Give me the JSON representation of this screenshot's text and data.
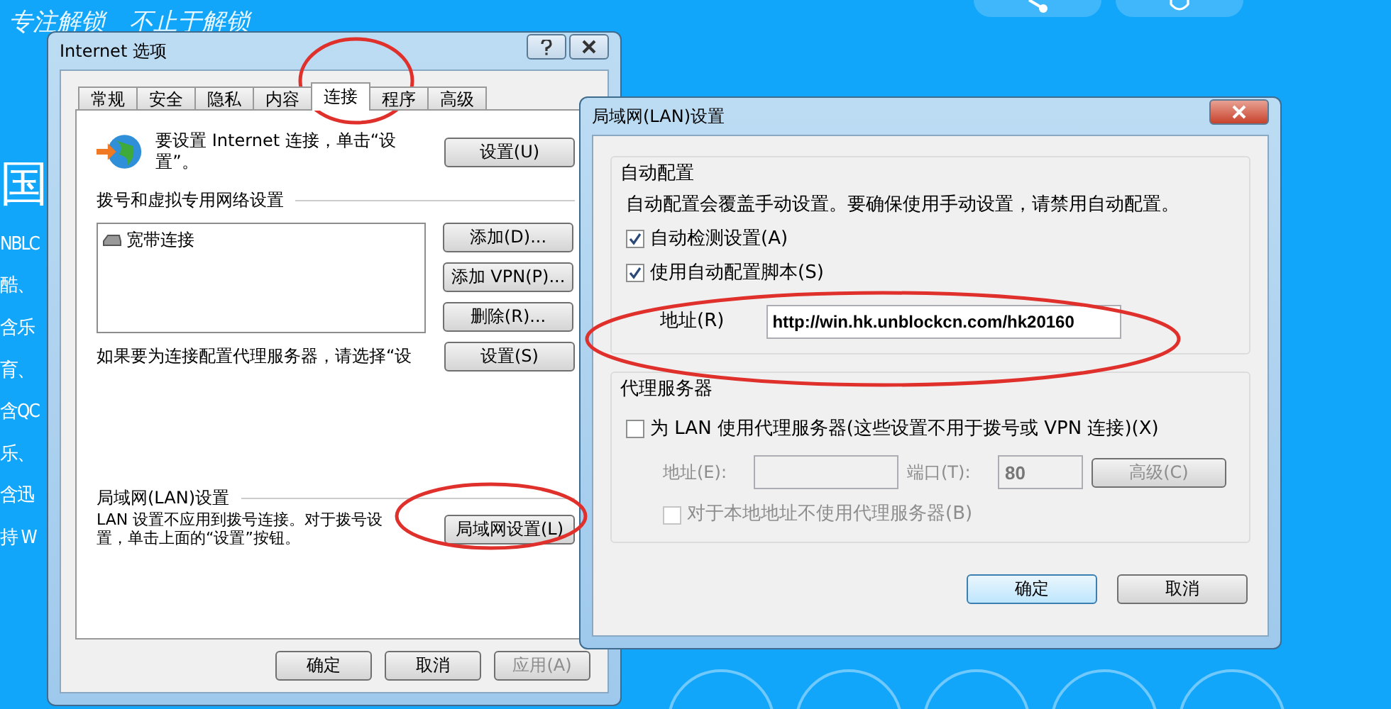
{
  "page": {
    "slogan": "专注解锁　不止于解锁",
    "side_texts": [
      "国",
      "NBLC",
      "酷、",
      "含乐",
      "育、",
      "含QC",
      "乐、",
      "含迅",
      "持 W"
    ]
  },
  "internet_options": {
    "title": "Internet 选项",
    "tabs": [
      {
        "label": "常规",
        "selected": false
      },
      {
        "label": "安全",
        "selected": false
      },
      {
        "label": "隐私",
        "selected": false
      },
      {
        "label": "内容",
        "selected": false
      },
      {
        "label": "连接",
        "selected": true
      },
      {
        "label": "程序",
        "selected": false
      },
      {
        "label": "高级",
        "selected": false
      }
    ],
    "setup_text": "要设置 Internet 连接，单击“设置”。",
    "setup_button": "设置(U)",
    "dialup_heading": "拨号和虚拟专用网络设置",
    "connections": [
      "宽带连接"
    ],
    "dialup_buttons": [
      "添加(D)...",
      "添加 VPN(P)...",
      "删除(R)..."
    ],
    "proxy_text": "如果要为连接配置代理服务器，请选择“设",
    "proxy_button": "设置(S)",
    "lan_heading": "局域网(LAN)设置",
    "lan_text": "LAN 设置不应用到拨号连接。对于拨号设置，单击上面的“设置”按钮。",
    "lan_button": "局域网设置(L)",
    "footer_buttons": [
      {
        "label": "确定",
        "disabled": false
      },
      {
        "label": "取消",
        "disabled": false
      },
      {
        "label": "应用(A)",
        "disabled": true
      }
    ]
  },
  "lan_settings": {
    "title": "局域网(LAN)设置",
    "auto_heading": "自动配置",
    "auto_note": "自动配置会覆盖手动设置。要确保使用手动设置，请禁用自动配置。",
    "auto_options": [
      {
        "label": "自动检测设置(A)",
        "checked": true
      },
      {
        "label": "使用自动配置脚本(S)",
        "checked": true
      }
    ],
    "address_label": "地址(R)",
    "address_value": "http://win.hk.unblockcn.com/hk20160",
    "proxy_heading": "代理服务器",
    "use_proxy": {
      "label": "为 LAN 使用代理服务器(这些设置不用于拨号或 VPN 连接)(X)",
      "checked": false
    },
    "proxy_address_label": "地址(E):",
    "port_label": "端口(T):",
    "port_value": "80",
    "advanced_button": "高级(C)",
    "bypass": {
      "label": "对于本地地址不使用代理服务器(B)",
      "checked": false
    },
    "proxy_disabled": true,
    "buttons": [
      {
        "label": "确定",
        "default": true
      },
      {
        "label": "取消",
        "default": false
      }
    ]
  }
}
